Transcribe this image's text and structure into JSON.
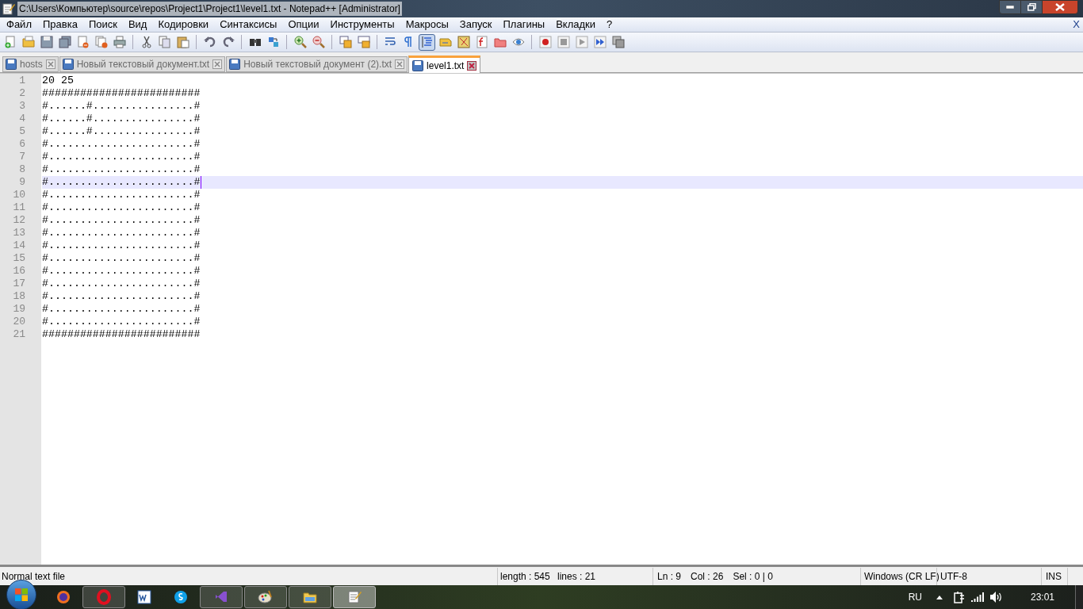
{
  "window": {
    "title": "C:\\Users\\Компьютер\\source\\repos\\Project1\\Project1\\level1.txt - Notepad++ [Administrator]"
  },
  "menu": {
    "items": [
      "Файл",
      "Правка",
      "Поиск",
      "Вид",
      "Кодировки",
      "Синтаксисы",
      "Опции",
      "Инструменты",
      "Макросы",
      "Запуск",
      "Плагины",
      "Вкладки",
      "?"
    ],
    "close": "X"
  },
  "toolbar": {
    "buttons": [
      {
        "pressed": false
      },
      {
        "pressed": false
      },
      {
        "pressed": false
      },
      {
        "pressed": false
      },
      {
        "pressed": false
      },
      {
        "pressed": false
      },
      {
        "pressed": false
      },
      {
        "pressed": false
      },
      {
        "pressed": false
      },
      {
        "pressed": false
      },
      {
        "pressed": false
      },
      {
        "pressed": false
      },
      {
        "pressed": false
      },
      {
        "pressed": false
      },
      {
        "pressed": false
      },
      {
        "pressed": false
      },
      {
        "pressed": false
      },
      {
        "pressed": false
      },
      {
        "pressed": false
      },
      {
        "pressed": false
      },
      {
        "pressed": true
      },
      {
        "pressed": false
      },
      {
        "pressed": false
      },
      {
        "pressed": false
      },
      {
        "pressed": false
      },
      {
        "pressed": false
      },
      {
        "pressed": false
      },
      {
        "pressed": false
      },
      {
        "pressed": false
      },
      {
        "pressed": false
      },
      {
        "pressed": false
      }
    ]
  },
  "tabs": [
    {
      "label": "hosts",
      "selected": false
    },
    {
      "label": "Новый текстовый документ.txt",
      "selected": false
    },
    {
      "label": "Новый текстовый документ (2).txt",
      "selected": false
    },
    {
      "label": "level1.txt",
      "selected": true
    }
  ],
  "editor": {
    "lines": [
      {
        "number": "1",
        "text": "20 25",
        "current": false
      },
      {
        "number": "2",
        "text": "#########################",
        "current": false
      },
      {
        "number": "3",
        "text": "#......#................#",
        "current": false
      },
      {
        "number": "4",
        "text": "#......#................#",
        "current": false
      },
      {
        "number": "5",
        "text": "#......#................#",
        "current": false
      },
      {
        "number": "6",
        "text": "#.......................#",
        "current": false
      },
      {
        "number": "7",
        "text": "#.......................#",
        "current": false
      },
      {
        "number": "8",
        "text": "#.......................#",
        "current": false
      },
      {
        "number": "9",
        "text": "#.......................#",
        "current": true
      },
      {
        "number": "10",
        "text": "#.......................#",
        "current": false
      },
      {
        "number": "11",
        "text": "#.......................#",
        "current": false
      },
      {
        "number": "12",
        "text": "#.......................#",
        "current": false
      },
      {
        "number": "13",
        "text": "#.......................#",
        "current": false
      },
      {
        "number": "14",
        "text": "#.......................#",
        "current": false
      },
      {
        "number": "15",
        "text": "#.......................#",
        "current": false
      },
      {
        "number": "16",
        "text": "#.......................#",
        "current": false
      },
      {
        "number": "17",
        "text": "#.......................#",
        "current": false
      },
      {
        "number": "18",
        "text": "#.......................#",
        "current": false
      },
      {
        "number": "19",
        "text": "#.......................#",
        "current": false
      },
      {
        "number": "20",
        "text": "#.......................#",
        "current": false
      },
      {
        "number": "21",
        "text": "#########################",
        "current": false
      }
    ]
  },
  "status_bar": {
    "file_type": "Normal text file",
    "length": "length : 545",
    "lines": "lines : 21",
    "ln": "Ln : 9",
    "col": "Col : 26",
    "sel": "Sel : 0 | 0",
    "eol": "Windows (CR LF)",
    "encoding": "UTF-8",
    "mode": "INS"
  },
  "taskbar": {
    "apps": [
      {
        "running": false,
        "selected": false
      },
      {
        "running": true,
        "selected": false
      },
      {
        "running": false,
        "selected": false
      },
      {
        "running": false,
        "selected": false
      },
      {
        "running": true,
        "selected": false
      },
      {
        "running": true,
        "selected": false
      },
      {
        "running": true,
        "selected": false
      },
      {
        "running": true,
        "selected": true
      }
    ],
    "language": "RU",
    "clock": "23:01"
  }
}
